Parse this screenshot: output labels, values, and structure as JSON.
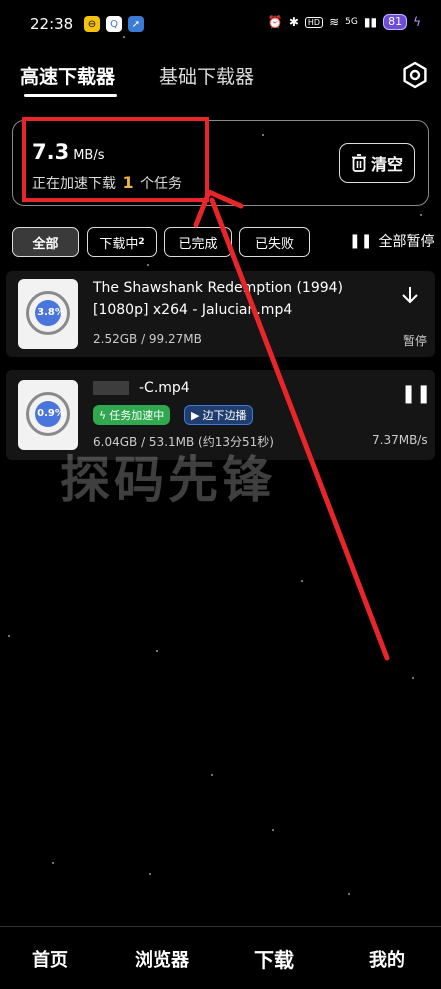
{
  "status_bar": {
    "time": "22:38",
    "battery": "81",
    "network_label": "5G",
    "hd_label": "HD",
    "icons": [
      "app-icon-yellow",
      "app-icon-search",
      "app-icon-rocket",
      "alarm-icon",
      "bluetooth-icon",
      "hd-icon",
      "wifi-icon",
      "signal-icon",
      "battery-icon",
      "charging-icon"
    ]
  },
  "tabs": {
    "high_speed": "高速下载器",
    "basic": "基础下载器"
  },
  "speed_card": {
    "speed_value": "7.3",
    "speed_unit": "MB/s",
    "accel_prefix": "正在加速下载",
    "accel_count": "1",
    "accel_suffix": "个任务",
    "clear_label": "清空"
  },
  "filters": {
    "all": "全部",
    "downloading": "下载中",
    "downloading_count": "2",
    "completed": "已完成",
    "failed": "已失败",
    "pause_all": "全部暂停"
  },
  "downloads": [
    {
      "title_line1": "The Shawshank Redemption (1994)",
      "title_line2": "[1080p] x264 - Jalucian.mp4",
      "progress_label": "3.8%",
      "progress": 0.038,
      "size": "2.52GB / 99.27MB",
      "status": "暂停"
    },
    {
      "title_line1": "-C.mp4",
      "progress_label": "0.9%",
      "progress": 0.009,
      "badge_accel": "任务加速中",
      "badge_stream": "边下边播",
      "size": "6.04GB / 53.1MB (约13分51秒)",
      "speed": "7.37MB/s"
    }
  ],
  "watermark": "探码先锋",
  "bottom_nav": {
    "home": "首页",
    "browser": "浏览器",
    "download": "下载",
    "mine": "我的"
  },
  "colors": {
    "background": "#000000",
    "accent_orange": "#f0b43c",
    "annotation_red": "#e8262a",
    "badge_green": "#2fa84f",
    "badge_blue": "#3a7bd5"
  }
}
